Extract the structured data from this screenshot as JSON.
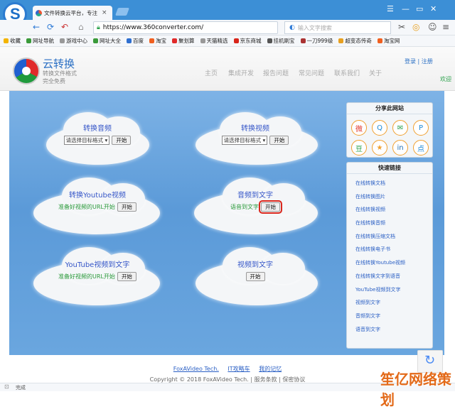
{
  "browser": {
    "tab_title": "文件转换云平台，专注",
    "url": "https://www.360converter.com/",
    "search_placeholder": "输入文字搜索",
    "bookmarks": [
      "收藏",
      "网址导航",
      "游戏中心",
      "网址大全",
      "百度",
      "淘宝",
      "聚划算",
      "天猫精选",
      "京东商城",
      "挂机刷宝",
      "一刀999级",
      "超变态传奇",
      "淘宝网"
    ],
    "status": "完成"
  },
  "site": {
    "name": "云转换",
    "sub1": "转换文件格式",
    "sub2": "完全免费",
    "nav": [
      "主页",
      "集成开发",
      "报告问题",
      "常见问题",
      "联系我们",
      "关于"
    ],
    "login": "登录 | 注册",
    "welcome": "欢迎"
  },
  "tools": {
    "audio": {
      "title": "转换音频",
      "select": "请选择目标格式 ▾",
      "start": "开始"
    },
    "video": {
      "title": "转换视频",
      "select": "请选择目标格式 ▾",
      "start": "开始"
    },
    "youtube": {
      "title": "转换Youtube视频",
      "hint": "准备好视频的URL开始",
      "start": "开始"
    },
    "audio_text": {
      "title": "音频到文字",
      "hint": "语音到文字",
      "start": "开始"
    },
    "youtube_text": {
      "title": "YouTube视频到文字",
      "hint": "准备好视频的URL开始",
      "start": "开始"
    },
    "video_text": {
      "title": "视频到文字",
      "start": "开始"
    }
  },
  "share": {
    "title": "分享此网站",
    "icons": [
      "weibo-icon",
      "qq-icon",
      "wechat-icon",
      "pinterest-icon",
      "douban-icon",
      "star-icon",
      "linkedin-icon",
      "diandian-icon"
    ]
  },
  "quicklinks": {
    "title": "快速链接",
    "items": [
      "在线转换文档",
      "在线转换图片",
      "在线转换视频",
      "在线转换音频",
      "在线转换压缩文档",
      "在线转换电子书",
      "在线转换Youtube视频",
      "在线转换文字到语音",
      "YouTube视频到文字",
      "视频到文字",
      "音频到文字",
      "语音到文字"
    ]
  },
  "footer": {
    "links": [
      "FoxAVideo Tech.",
      "IT攻略车",
      "我的记忆"
    ],
    "copyright": "Copyright © 2018 FoxAVideo Tech. | 服务条款 | 保密协议"
  },
  "watermark": "笙亿网络策划"
}
